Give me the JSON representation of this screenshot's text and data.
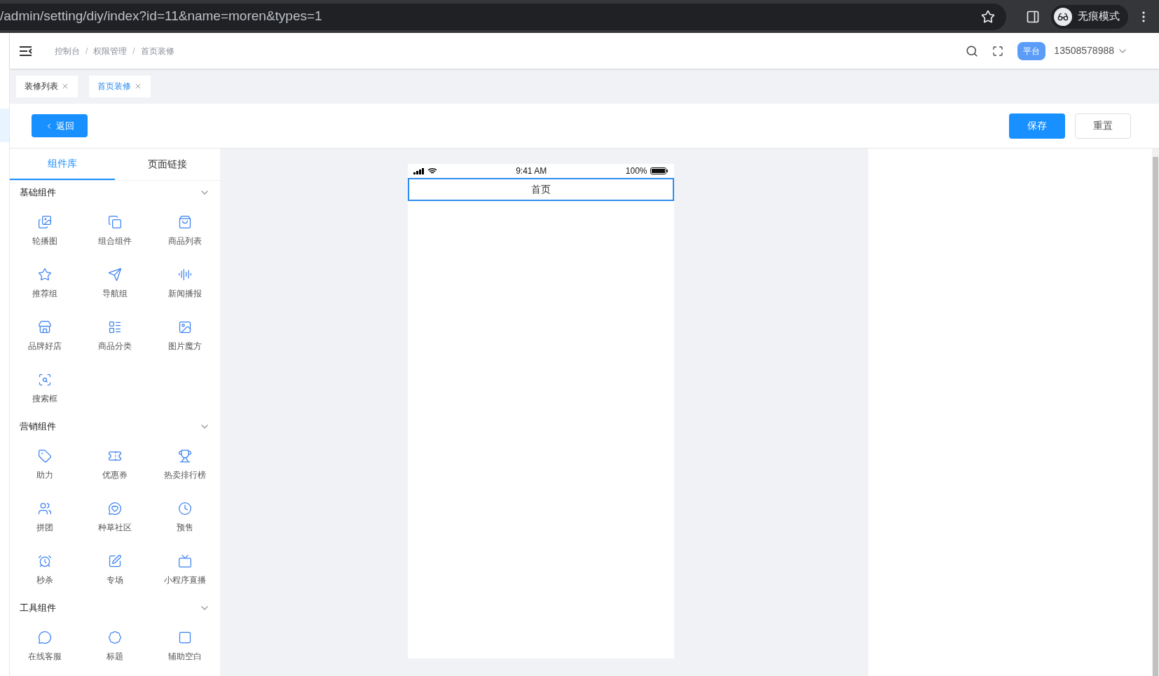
{
  "browser": {
    "url": "/admin/setting/diy/index?id=11&name=moren&types=1",
    "profile": "无痕模式"
  },
  "header": {
    "breadcrumb": [
      "控制台",
      "权限管理",
      "首页装修"
    ],
    "separator": "/",
    "badge": "平台",
    "user": "13508578988"
  },
  "page_tabs": [
    {
      "label": "装修列表",
      "selected": false
    },
    {
      "label": "首页装修",
      "selected": true
    }
  ],
  "toolbar": {
    "back": "返回",
    "save": "保存",
    "reset": "重置"
  },
  "panel_tabs": [
    {
      "label": "组件库",
      "selected": true
    },
    {
      "label": "页面链接",
      "selected": false
    }
  ],
  "sections": [
    {
      "title": "基础组件",
      "expanded": true,
      "items": [
        "轮播图",
        "组合组件",
        "商品列表",
        "推荐组",
        "导航组",
        "新闻播报",
        "品牌好店",
        "商品分类",
        "图片魔方",
        "搜索框"
      ]
    },
    {
      "title": "营销组件",
      "expanded": true,
      "items": [
        "助力",
        "优惠券",
        "热卖排行榜",
        "拼团",
        "种草社区",
        "预售",
        "秒杀",
        "专场",
        "小程序直播"
      ]
    },
    {
      "title": "工具组件",
      "expanded": true,
      "items": [
        "在线客服",
        "标题",
        "辅助空白"
      ]
    }
  ],
  "phone": {
    "time": "9:41 AM",
    "battery": "100%",
    "title": "首页",
    "title_selected": true
  }
}
